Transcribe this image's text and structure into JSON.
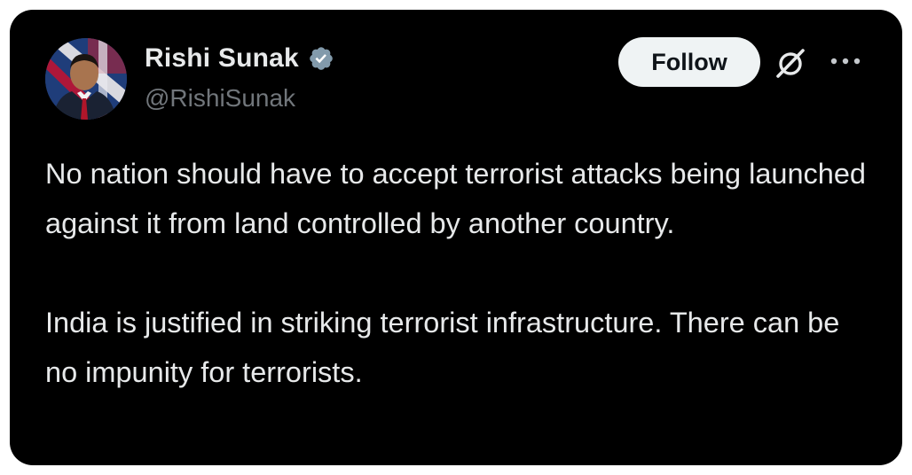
{
  "tweet": {
    "author": {
      "name": "Rishi Sunak",
      "handle": "@RishiSunak",
      "verified": true,
      "verified_badge_color": "#829aab"
    },
    "follow_label": "Follow",
    "icons": {
      "avatar": "profile-photo",
      "badge": "verified-badge-icon",
      "grok": "grok-icon",
      "more": "more-options-icon"
    },
    "paragraphs": [
      "No nation should have to accept terrorist attacks being launched against it from land controlled by another country.",
      "India is justified in striking terrorist infrastructure. There can be no impunity for terrorists."
    ]
  },
  "colors": {
    "background": "#000000",
    "text": "#e7e9ea",
    "secondary_text": "#71767b",
    "button_bg": "#eff3f4",
    "button_text": "#0f1419"
  }
}
